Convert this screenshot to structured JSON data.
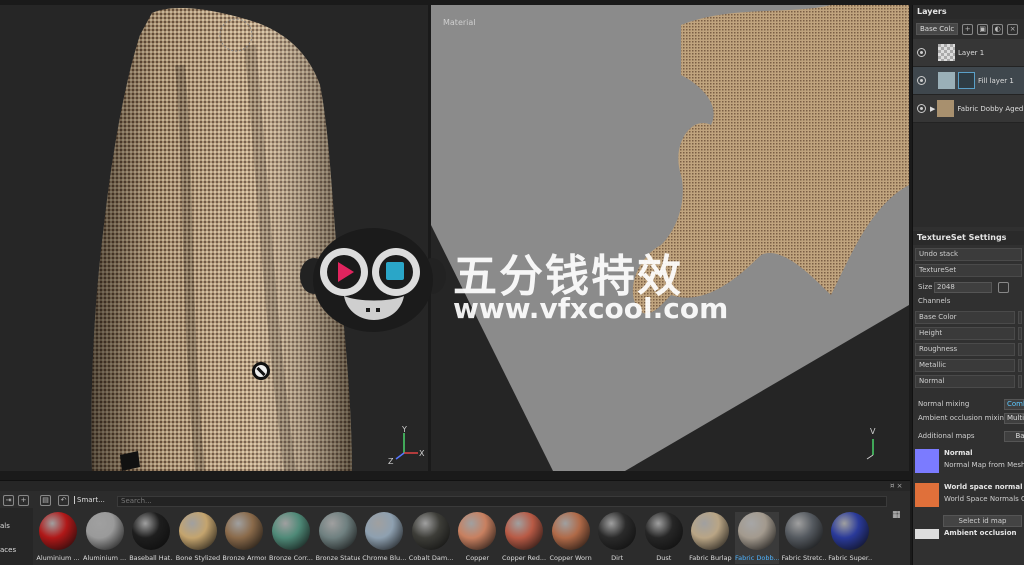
{
  "viewport2d": {
    "label": "Material"
  },
  "gizmo3d": {
    "y": "Y",
    "x": "X",
    "z": "Z"
  },
  "gizmo2d": {
    "v": "V"
  },
  "layers": {
    "title": "Layers",
    "channel_select": "Base Colc",
    "items": [
      {
        "name": "Layer 1"
      },
      {
        "name": "Fill layer 1"
      },
      {
        "name": "Fabric Dobby Aged"
      }
    ]
  },
  "textureset": {
    "title": "TextureSet Settings",
    "undo_stack": "Undo stack",
    "textureset_label": "TextureSet",
    "size_label": "Size",
    "size_value": "2048",
    "channels_label": "Channels",
    "channels": [
      "Base Color",
      "Height",
      "Roughness",
      "Metallic",
      "Normal"
    ],
    "normal_mixing_label": "Normal mixing",
    "normal_mixing_value": "Combi",
    "ao_mixing_label": "Ambient occlusion mixing",
    "ao_mixing_value": "Multip",
    "additional_maps_label": "Additional maps",
    "additional_maps_button": "Ba",
    "maps": [
      {
        "title": "Normal",
        "subtitle": "Normal Map from Mesh N",
        "color": "#7b7bff"
      },
      {
        "title": "World space normal",
        "subtitle": "World Space Normals Cl",
        "color": "#e0703a"
      }
    ],
    "select_id_map": "Select id map",
    "ambient_occlusion": "Ambient occlusion"
  },
  "shelf": {
    "tab_label": "Smart...",
    "search_placeholder": "Search...",
    "left_labels": [
      "als",
      "aces"
    ],
    "materials": [
      {
        "name": "Aluminium ...",
        "color": "#b01818"
      },
      {
        "name": "Aluminium ...",
        "color": "#9a9a9a"
      },
      {
        "name": "Baseball Hat...",
        "color": "#1e1e1e"
      },
      {
        "name": "Bone Stylized",
        "color": "#c4a46e"
      },
      {
        "name": "Bronze Armor",
        "color": "#8a6a4a"
      },
      {
        "name": "Bronze Corr...",
        "color": "#4f8a78"
      },
      {
        "name": "Bronze Statue",
        "color": "#6f8080"
      },
      {
        "name": "Chrome Blu...",
        "color": "#8ea0b0"
      },
      {
        "name": "Cobalt Dam...",
        "color": "#3d3d38"
      },
      {
        "name": "Copper",
        "color": "#c88060"
      },
      {
        "name": "Copper Red...",
        "color": "#b85a45"
      },
      {
        "name": "Copper Worn",
        "color": "#b06a48"
      },
      {
        "name": "Dirt",
        "color": "#2a2a2a"
      },
      {
        "name": "Dust",
        "color": "#262626"
      },
      {
        "name": "Fabric Burlap",
        "color": "#b9a585"
      },
      {
        "name": "Fabric Dobb...",
        "color": "#a39a8e"
      },
      {
        "name": "Fabric Stretc...",
        "color": "#555a60"
      },
      {
        "name": "Fabric Super...",
        "color": "#2a3a9a"
      }
    ]
  },
  "watermark": {
    "title": "五分钱特效",
    "url": "www.vfxcool.com"
  },
  "colors": {
    "accent": "#4fb4ff",
    "panel": "#303030",
    "viewport": "#262626"
  }
}
